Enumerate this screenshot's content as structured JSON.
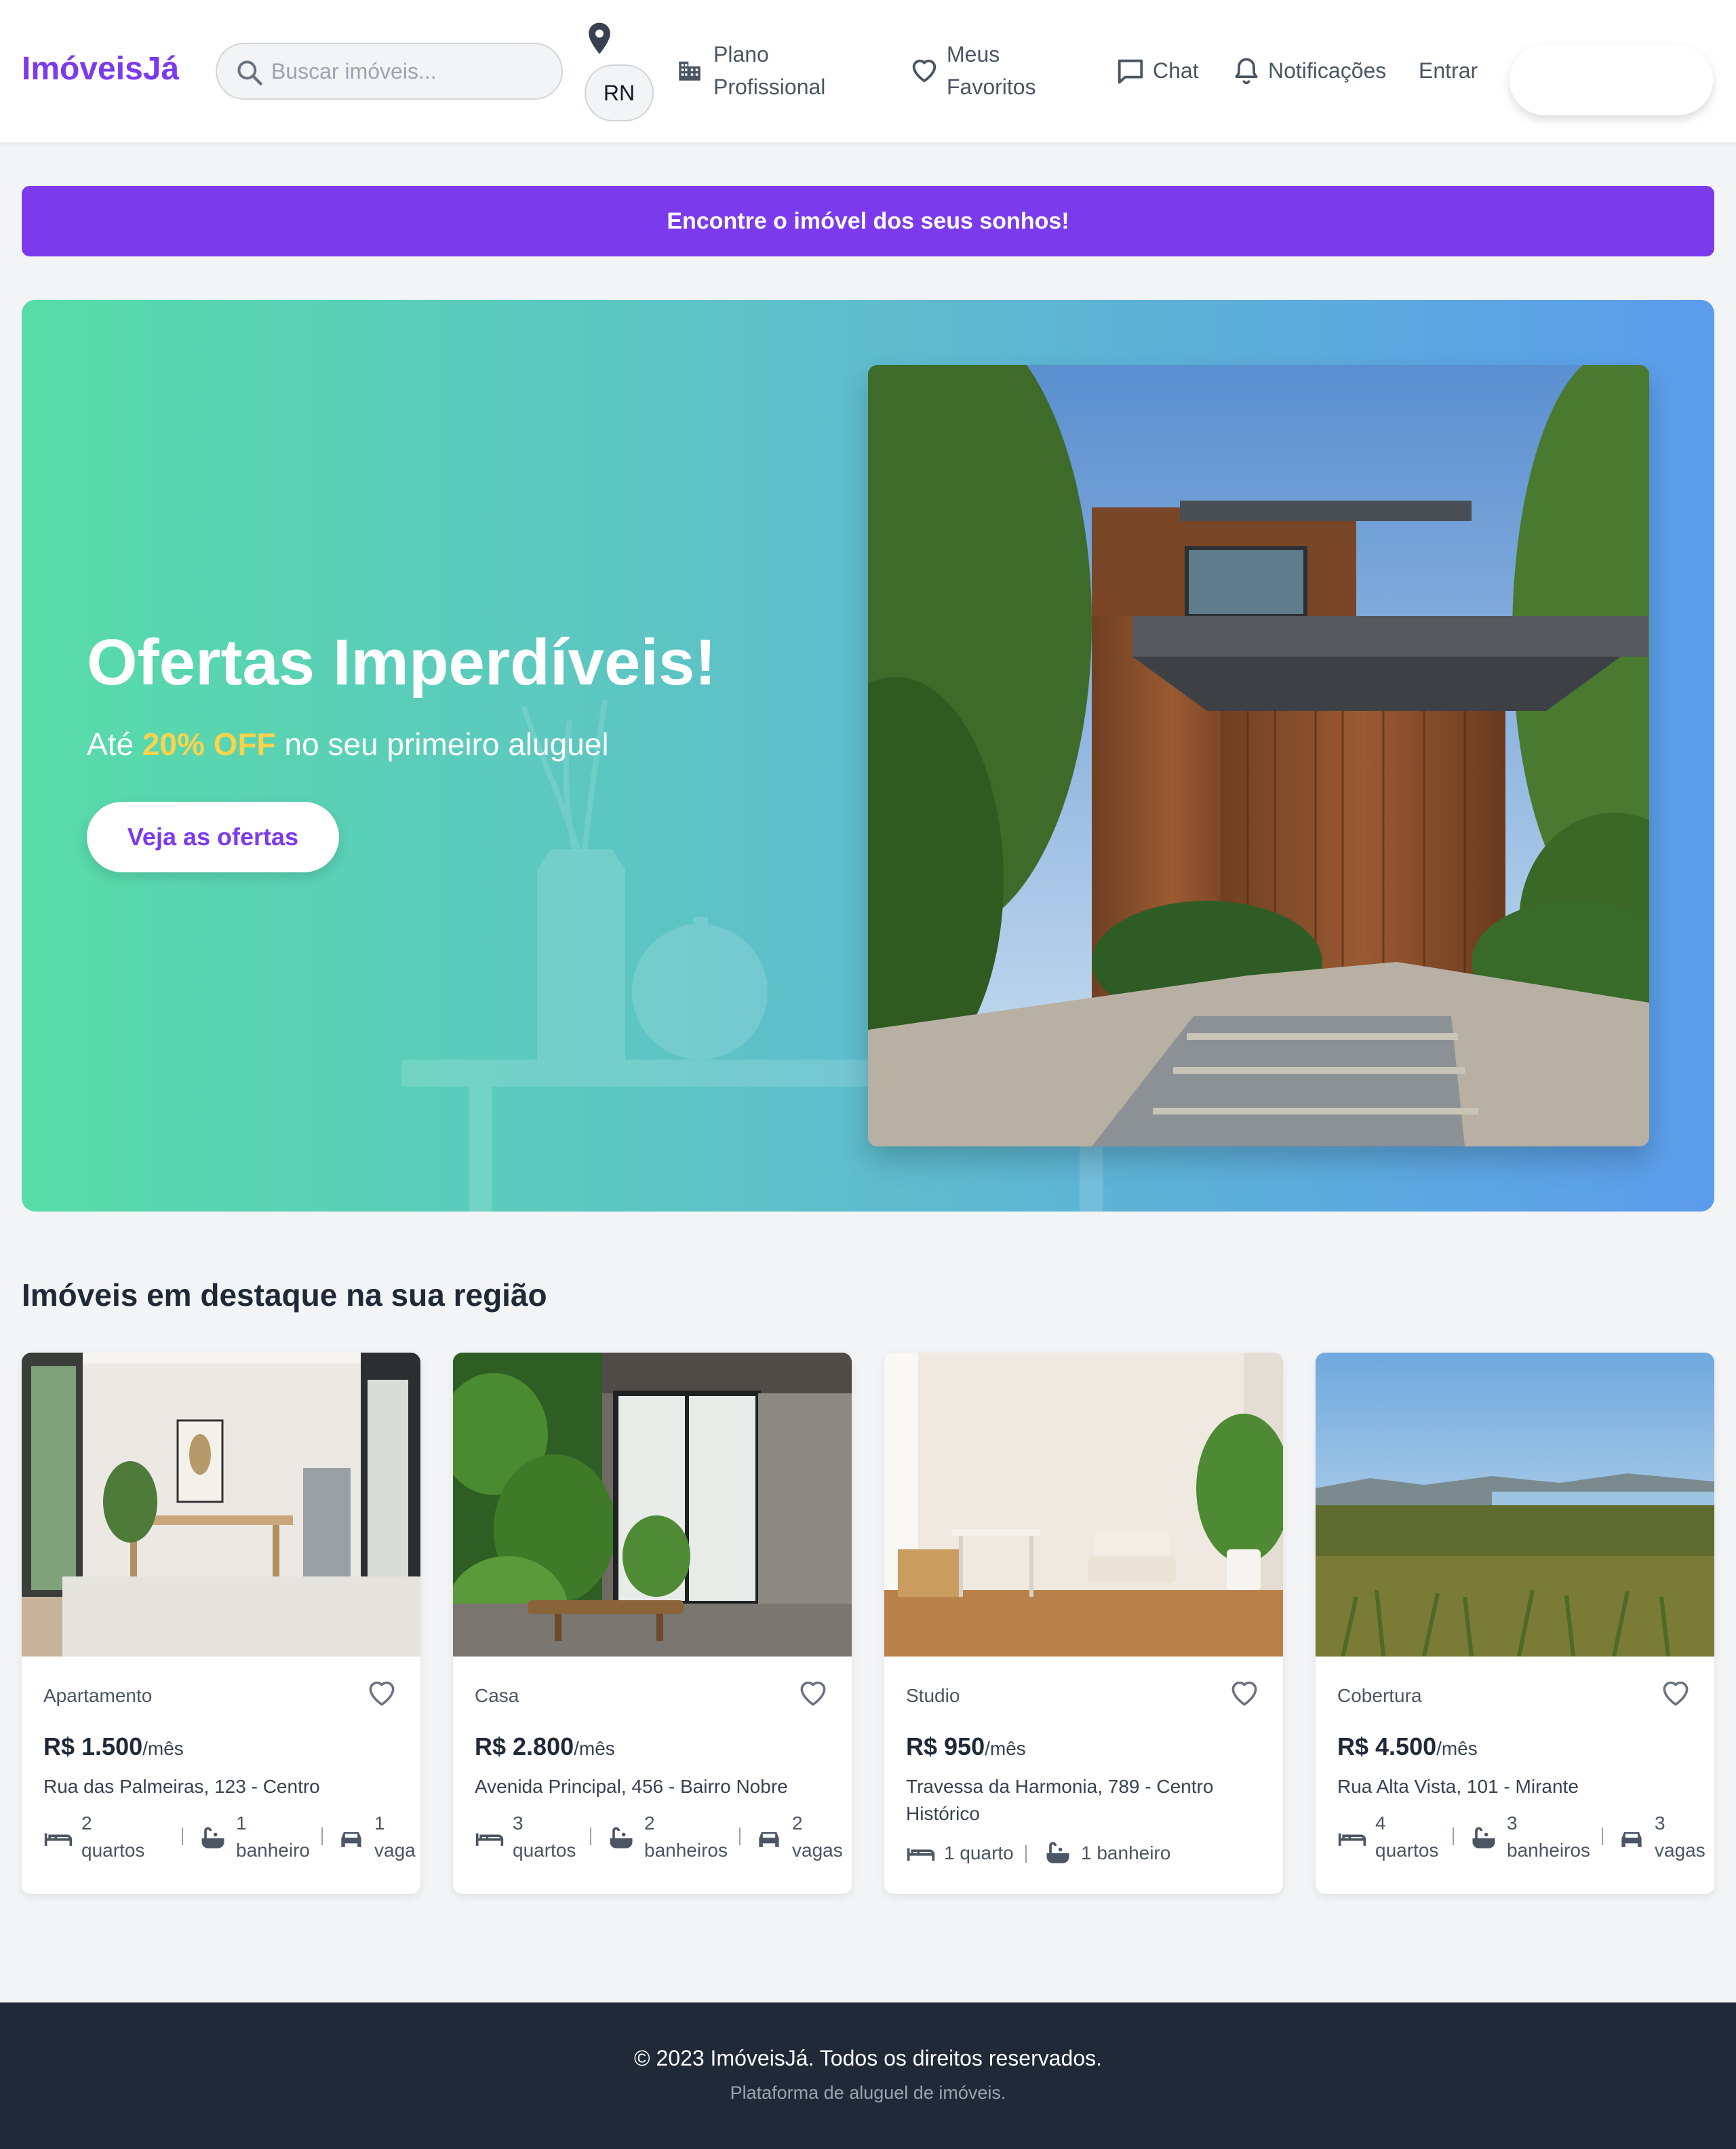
{
  "header": {
    "logo": "ImóveisJá",
    "search_placeholder": "Buscar imóveis...",
    "location_state": "RN",
    "nav": {
      "plano_line1": "Plano",
      "plano_line2": "Profissional",
      "favoritos_line1": "Meus",
      "favoritos_line2": "Favoritos",
      "chat": "Chat",
      "notificacoes": "Notificações",
      "entrar": "Entrar"
    }
  },
  "promo_bar": {
    "text": "Encontre o imóvel dos seus sonhos!"
  },
  "hero": {
    "title": "Ofertas Imperdíveis!",
    "subtitle_before": "Até ",
    "subtitle_highlight": "20% OFF",
    "subtitle_after": " no seu primeiro aluguel",
    "cta": "Veja as ofertas",
    "highlight_color": "#fcd34d"
  },
  "featured": {
    "title": "Imóveis em destaque na sua região",
    "listings": [
      {
        "type": "Apartamento",
        "price": "R$ 1.500",
        "price_unit": "/mês",
        "address": "Rua das Palmeiras, 123 - Centro",
        "bedrooms_num": "2",
        "bedrooms_label": "quartos",
        "bathrooms_num": "1",
        "bathrooms_label": "banheiro",
        "parking_num": "1",
        "parking_label": "vaga"
      },
      {
        "type": "Casa",
        "price": "R$ 2.800",
        "price_unit": "/mês",
        "address": "Avenida Principal, 456 - Bairro Nobre",
        "bedrooms_num": "3",
        "bedrooms_label": "quartos",
        "bathrooms_num": "2",
        "bathrooms_label": "banheiros",
        "parking_num": "2",
        "parking_label": "vagas"
      },
      {
        "type": "Studio",
        "price": "R$ 950",
        "price_unit": "/mês",
        "address": "Travessa da Harmonia, 789 - Centro Histórico",
        "bedrooms_text": "1 quarto",
        "bathrooms_text": "1 banheiro"
      },
      {
        "type": "Cobertura",
        "price": "R$ 4.500",
        "price_unit": "/mês",
        "address": "Rua Alta Vista, 101 - Mirante",
        "bedrooms_num": "4",
        "bedrooms_label": "quartos",
        "bathrooms_num": "3",
        "bathrooms_label": "banheiros",
        "parking_num": "3",
        "parking_label": "vagas"
      }
    ]
  },
  "footer": {
    "copyright": "© 2023 ImóveisJá. Todos os direitos reservados.",
    "tagline": "Plataforma de aluguel de imóveis."
  },
  "colors": {
    "brand": "#7c3aed",
    "footer_bg": "#1f2937",
    "page_bg": "#f3f4f6"
  },
  "icons": [
    "search-icon",
    "location-pin-icon",
    "building-icon",
    "heart-icon",
    "chat-icon",
    "bell-icon",
    "bed-icon",
    "bathtub-icon",
    "car-icon"
  ]
}
